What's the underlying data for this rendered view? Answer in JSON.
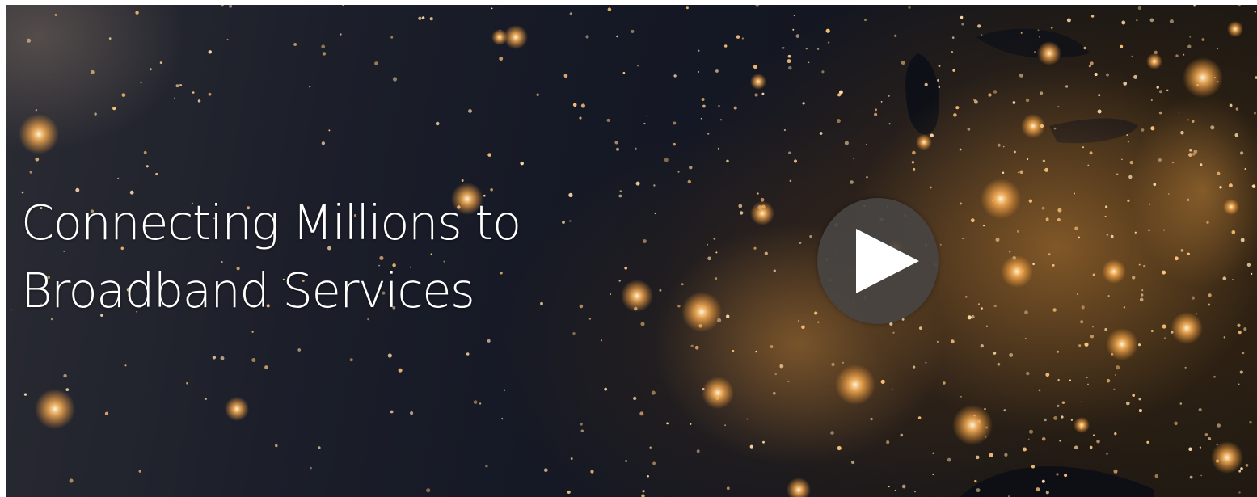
{
  "hero": {
    "headline_line1": "Connecting Millions to",
    "headline_line2": "Broadband Services",
    "background_icon": "night-earth-lights-image",
    "play_icon": "play-icon",
    "colors": {
      "headline": "#ffffff",
      "play_button": "#484442",
      "city_lights": "#ffb55a"
    }
  }
}
